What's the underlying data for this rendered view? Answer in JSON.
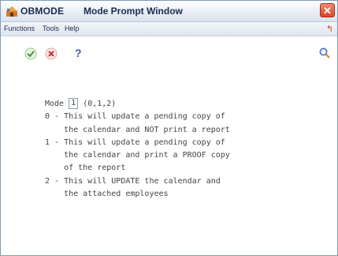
{
  "window": {
    "app_name": "OBMODE",
    "title": "Mode Prompt Window",
    "close_glyph": "✕"
  },
  "menu": {
    "functions": "Functions",
    "tools": "Tools",
    "help": "Help"
  },
  "toolbar": {
    "ok_icon": "check-icon",
    "cancel_icon": "cancel-icon",
    "help_glyph": "?",
    "search_icon": "search-icon"
  },
  "form": {
    "mode_label": "Mode",
    "mode_value": "1",
    "mode_options": "(0,1,2)",
    "lines": [
      "0 - This will update a pending copy of",
      "    the calendar and NOT print a report",
      "1 - This will update a pending copy of",
      "    the calendar and print a PROOF copy",
      "    of the report",
      "2 - This will UPDATE the calendar and",
      "    the attached employees"
    ]
  },
  "colors": {
    "title_text": "#1a2a50",
    "close": "#d9472a",
    "ok": "#3a9a2a",
    "cancel": "#d03030"
  }
}
